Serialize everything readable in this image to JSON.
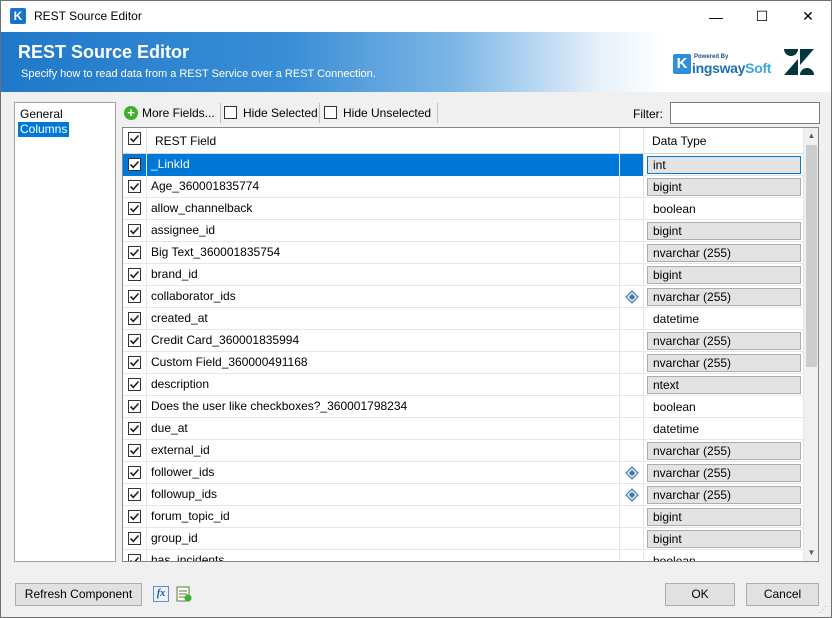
{
  "window": {
    "title": "REST Source Editor",
    "minimize": "—",
    "maximize": "☐",
    "close": "✕"
  },
  "banner": {
    "title": "REST Source Editor",
    "subtitle": "Specify how to read data from a REST Service over a REST Connection.",
    "logo_powered": "Powered By",
    "logo_k": "K",
    "logo_name": "ingsway",
    "logo_soft": "Soft"
  },
  "nav": {
    "items": [
      {
        "label": "General"
      },
      {
        "label": "Columns"
      }
    ]
  },
  "toolbar": {
    "more_fields": "More Fields...",
    "hide_selected": "Hide Selected",
    "hide_unselected": "Hide Unselected",
    "filter_label": "Filter:",
    "filter_value": ""
  },
  "grid": {
    "headers": {
      "field": "REST Field",
      "type": "Data Type"
    },
    "rows": [
      {
        "field": "_LinkId",
        "type": "int",
        "style": "sel",
        "icon": false,
        "selected": true
      },
      {
        "field": "Age_360001835774",
        "type": "bigint",
        "style": "grey",
        "icon": false
      },
      {
        "field": "allow_channelback",
        "type": "boolean",
        "style": "plain",
        "icon": false
      },
      {
        "field": "assignee_id",
        "type": "bigint",
        "style": "grey",
        "icon": false
      },
      {
        "field": "Big Text_360001835754",
        "type": "nvarchar (255)",
        "style": "grey",
        "icon": false
      },
      {
        "field": "brand_id",
        "type": "bigint",
        "style": "grey",
        "icon": false
      },
      {
        "field": "collaborator_ids",
        "type": "nvarchar (255)",
        "style": "grey",
        "icon": true
      },
      {
        "field": "created_at",
        "type": "datetime",
        "style": "plain",
        "icon": false
      },
      {
        "field": "Credit Card_360001835994",
        "type": "nvarchar (255)",
        "style": "grey",
        "icon": false
      },
      {
        "field": "Custom Field_360000491168",
        "type": "nvarchar (255)",
        "style": "grey",
        "icon": false
      },
      {
        "field": "description",
        "type": "ntext",
        "style": "grey",
        "icon": false
      },
      {
        "field": "Does the user like checkboxes?_360001798234",
        "type": "boolean",
        "style": "plain",
        "icon": false
      },
      {
        "field": "due_at",
        "type": "datetime",
        "style": "plain",
        "icon": false
      },
      {
        "field": "external_id",
        "type": "nvarchar (255)",
        "style": "grey",
        "icon": false
      },
      {
        "field": "follower_ids",
        "type": "nvarchar (255)",
        "style": "grey",
        "icon": true
      },
      {
        "field": "followup_ids",
        "type": "nvarchar (255)",
        "style": "grey",
        "icon": true
      },
      {
        "field": "forum_topic_id",
        "type": "bigint",
        "style": "grey",
        "icon": false
      },
      {
        "field": "group_id",
        "type": "bigint",
        "style": "grey",
        "icon": false
      },
      {
        "field": "has_incidents",
        "type": "boolean",
        "style": "plain",
        "icon": false
      }
    ]
  },
  "footer": {
    "refresh": "Refresh Component",
    "fx": "fx",
    "ok": "OK",
    "cancel": "Cancel"
  },
  "colors": {
    "accent": "#0078d7",
    "banner": "#1f78c9",
    "add": "#3fae2a"
  }
}
